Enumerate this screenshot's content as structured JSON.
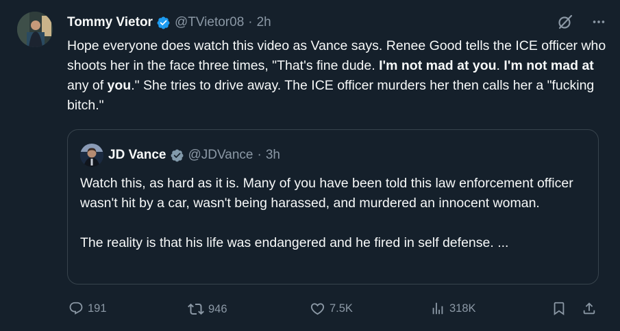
{
  "tweet": {
    "author_name": "Tommy Vietor",
    "handle": "@TVietor08",
    "time": "2h",
    "text_parts": [
      {
        "t": "Hope everyone does watch this video as Vance says. Renee Good tells the ICE officer who shoots her in the face three times, \"That's fine dude. ",
        "b": false
      },
      {
        "t": "I'm not mad at you",
        "b": true
      },
      {
        "t": ". ",
        "b": false
      },
      {
        "t": "I'm not mad at",
        "b": true
      },
      {
        "t": " any of ",
        "b": false
      },
      {
        "t": "you",
        "b": true
      },
      {
        "t": ".\" She tries to drive away. The ICE officer murders her then calls her a \"fucking bitch.\"",
        "b": false
      }
    ]
  },
  "quote": {
    "author_name": "JD Vance",
    "handle": "@JDVance",
    "time": "3h",
    "paragraph1": "Watch this, as hard as it is. Many of you have been told this law enforcement officer wasn't hit by a car, wasn't being harassed, and murdered an innocent woman.",
    "paragraph2": "The reality is that his life was endangered and he fired in self defense. ..."
  },
  "actions": {
    "replies": "191",
    "reposts": "946",
    "likes": "7.5K",
    "views": "318K"
  },
  "icons": {
    "verified_color": "#1d9bf0",
    "quote_verified_color": "#829aab",
    "muted_color": "#8b98a5"
  }
}
